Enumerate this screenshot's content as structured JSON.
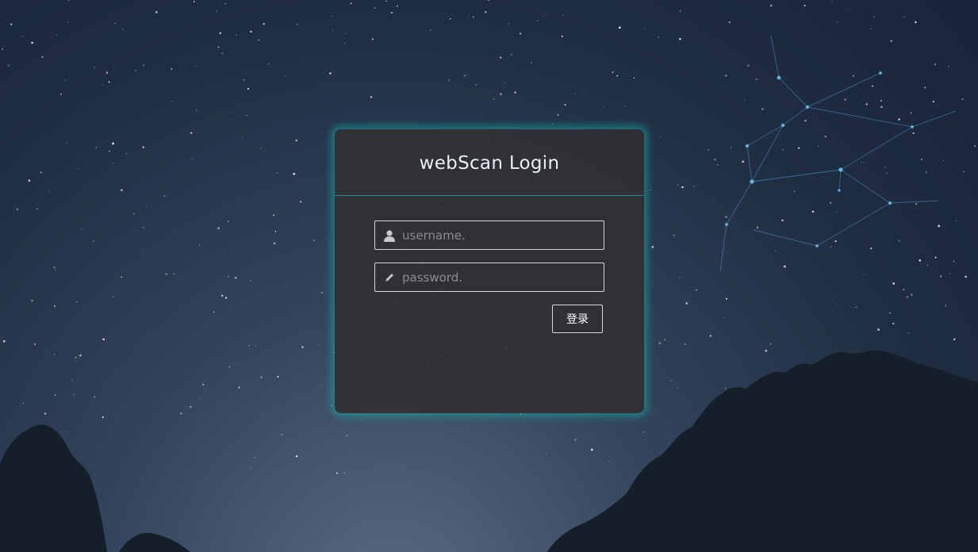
{
  "login": {
    "title": "webScan Login",
    "username_placeholder": "username.",
    "password_placeholder": "password.",
    "submit_label": "登录"
  },
  "icons": {
    "username": "user-icon",
    "password": "pencil-icon"
  },
  "colors": {
    "accent_glow": "#16aaaa",
    "panel_bg": "#303034",
    "text": "#e6eef6"
  }
}
